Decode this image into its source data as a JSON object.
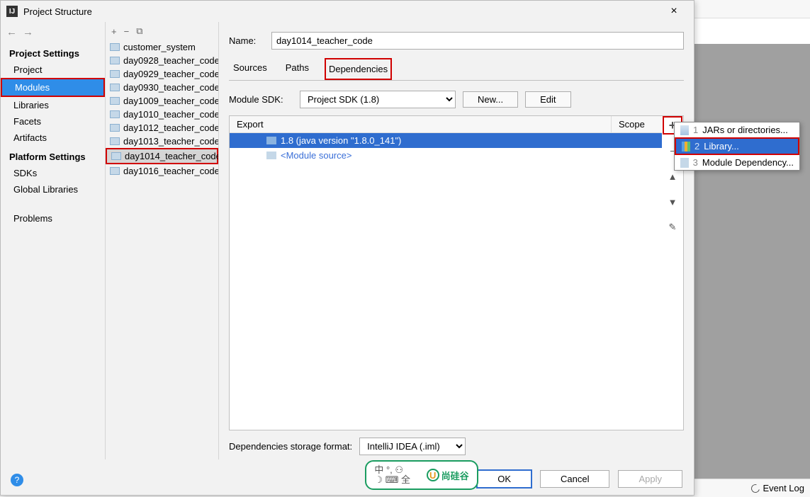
{
  "dialog": {
    "title": "Project Structure",
    "close_label": "×"
  },
  "nav": {
    "back": "←",
    "fwd": "→"
  },
  "left": {
    "section1": "Project Settings",
    "items1": [
      "Project",
      "Modules",
      "Libraries",
      "Facets",
      "Artifacts"
    ],
    "section2": "Platform Settings",
    "items2": [
      "SDKs",
      "Global Libraries"
    ],
    "section3_item": "Problems"
  },
  "middle_toolbar": {
    "add": "+",
    "remove": "−",
    "copy": "⧉"
  },
  "modules": [
    "customer_system",
    "day0928_teacher_code",
    "day0929_teacher_code",
    "day0930_teacher_code",
    "day1009_teacher_code",
    "day1010_teacher_code",
    "day1012_teacher_code",
    "day1013_teacher_code",
    "day1014_teacher_code",
    "day1016_teacher_code"
  ],
  "modules_selected_index": 8,
  "right": {
    "name_label": "Name:",
    "name_value": "day1014_teacher_code",
    "tabs": [
      "Sources",
      "Paths",
      "Dependencies"
    ],
    "selected_tab_index": 2,
    "sdk_label": "Module SDK:",
    "sdk_value": "Project SDK (1.8)",
    "new_btn": "New...",
    "edit_btn": "Edit",
    "col_export": "Export",
    "col_scope": "Scope",
    "dep0": "1.8 (java version \"1.8.0_141\")",
    "dep1": "<Module source>",
    "storage_label": "Dependencies storage format:",
    "storage_value": "IntelliJ IDEA (.iml)"
  },
  "side": {
    "add": "+",
    "remove": "−",
    "up": "▲",
    "down": "▼",
    "edit": "✎"
  },
  "popup": {
    "items": [
      {
        "num": "1",
        "label": "JARs or directories..."
      },
      {
        "num": "2",
        "label": "Library..."
      },
      {
        "num": "3",
        "label": "Module Dependency..."
      }
    ],
    "selected_index": 1
  },
  "footer": {
    "ok": "OK",
    "cancel": "Cancel",
    "apply": "Apply",
    "help": "?"
  },
  "watermark": {
    "left1": "中 °,  ⚇",
    "left2": "☽ ⌨ 全",
    "right": "尚硅谷",
    "logo": "U"
  },
  "bg": {
    "event_log": "Event Log"
  }
}
